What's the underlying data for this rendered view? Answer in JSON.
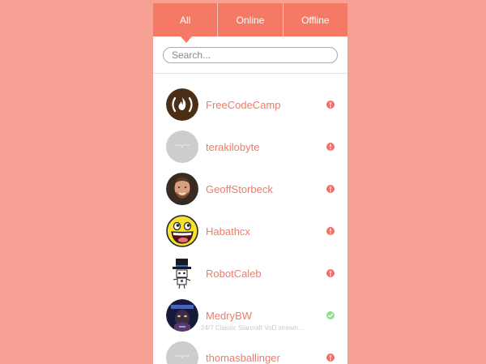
{
  "tabs": [
    {
      "label": "All",
      "active": true
    },
    {
      "label": "Online"
    },
    {
      "label": "Offline"
    }
  ],
  "search": {
    "placeholder": "Search...",
    "value": ""
  },
  "channels": [
    {
      "name": "FreeCodeCamp",
      "status": "offline",
      "avatar": "freecodecamp-logo"
    },
    {
      "name": "terakilobyte",
      "status": "offline",
      "avatar": "placeholder",
      "avatar_text": "***x***"
    },
    {
      "name": "GeoffStorbeck",
      "status": "offline",
      "avatar": "profile-photo"
    },
    {
      "name": "Habathcx",
      "status": "offline",
      "avatar": "awesome-face"
    },
    {
      "name": "RobotCaleb",
      "status": "offline",
      "avatar": "robot-top-hat"
    },
    {
      "name": "MedryBW",
      "status": "online",
      "avatar": "starcraft-art",
      "stream": "24/7 Classic Starcraft VoD stream..."
    },
    {
      "name": "thomasballinger",
      "status": "offline",
      "avatar": "placeholder",
      "avatar_text": "***x***"
    }
  ],
  "colors": {
    "background": "#f7a194",
    "accent": "#f47a66",
    "offline": "#f26e66",
    "online": "#8fe08a"
  },
  "icons": {
    "offline": "exclamation-icon",
    "online": "checkmark-icon"
  }
}
